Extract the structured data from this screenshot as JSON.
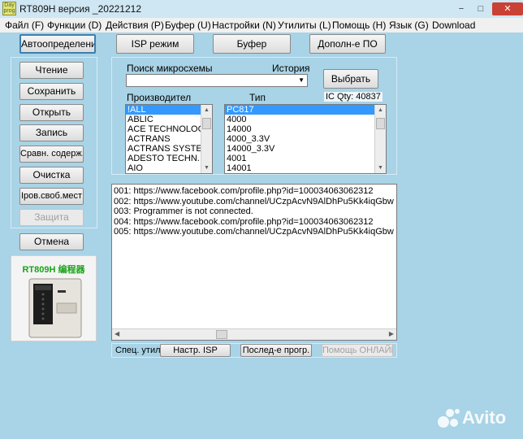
{
  "window": {
    "title": "RT809H версия _20221212",
    "app_icon_text": "Day prog",
    "controls": {
      "minimize": "−",
      "maximize": "□",
      "close": "✕"
    }
  },
  "menu": [
    "Файл (F)",
    "Функции (D)",
    "Действия (P)",
    "Буфер (U)",
    "Настройки (N)",
    "Утилиты (L)",
    "Помощь (H)",
    "Язык (G)",
    "Download"
  ],
  "top_buttons": {
    "auto": "Автоопределение",
    "isp": "ISP режим",
    "buffer": "Буфер",
    "extra": "Дополн-е ПО"
  },
  "side_buttons": {
    "read": "Чтение",
    "save": "Сохранить",
    "open": "Открыть",
    "write": "Запись",
    "compare": "Сравн. содерж.",
    "clear": "Очистка",
    "blank": "Iров.своб.мест",
    "protect": "Защита",
    "cancel": "Отмена"
  },
  "chip_search": {
    "search_label": "Поиск микросхемы",
    "history_label": "История",
    "search_value": "",
    "select_button": "Выбрать",
    "ic_qty": "IC Qty: 40837",
    "manufacturer_label": "Производител",
    "type_label": "Тип",
    "manufacturers": [
      "!ALL",
      "ABLIC",
      "ACE TECHNOLOG",
      "ACTRANS",
      "ACTRANS SYSTE",
      "ADESTO TECHN.",
      "AIO"
    ],
    "types": [
      "PC817",
      "4000",
      "14000",
      "4000_3.3V",
      "14000_3.3V",
      "4001",
      "14001"
    ]
  },
  "log": {
    "lines": [
      "001:  https://www.facebook.com/profile.php?id=100034063062312",
      "002:  https://www.youtube.com/channel/UCzpAcvN9AlDhPu5Kk4iqGbw",
      "003:  Programmer is not connected.",
      "004:  https://www.facebook.com/profile.php?id=100034063062312",
      "005:  https://www.youtube.com/channel/UCzpAcvN9AlDhPu5Kk4iqGbw"
    ]
  },
  "bottom_bar": {
    "util_label": "Спец. утил",
    "isp_settings": "Настр. ISP",
    "last_prog": "Послед-е прогр.",
    "online_help": "Помощь ОНЛАЙН"
  },
  "programmer_image": {
    "caption": "RT809H 编程器"
  },
  "watermark": "Avito",
  "colors": {
    "background": "#a9d3e6",
    "selection": "#3399ff",
    "caption_green": "#19a319"
  }
}
